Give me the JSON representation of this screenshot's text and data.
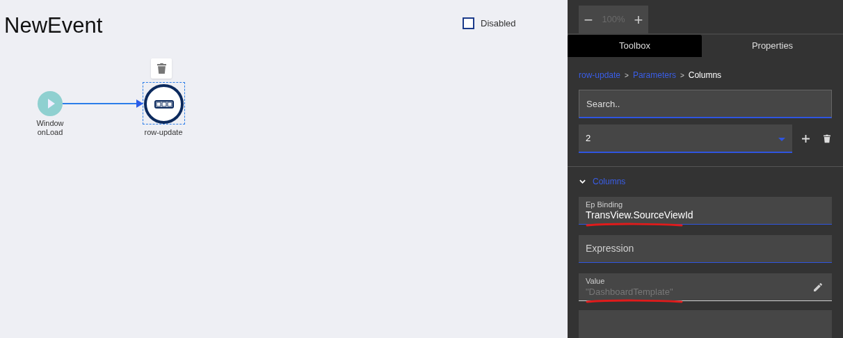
{
  "canvas": {
    "title": "NewEvent",
    "disabled_option": {
      "label": "Disabled",
      "checked": false
    },
    "nodes": [
      {
        "kind": "start",
        "label": "Window onLoad",
        "selected": false
      },
      {
        "kind": "action",
        "label": "row-update",
        "selected": true
      }
    ]
  },
  "panel": {
    "zoom": {
      "minus": "−",
      "value": "100%",
      "plus": "+"
    },
    "tabs": [
      {
        "label": "Toolbox",
        "selected": true
      },
      {
        "label": "Properties",
        "selected": false
      }
    ],
    "breadcrumb": [
      {
        "label": "row-update",
        "current": false
      },
      {
        "label": "Parameters",
        "current": false
      },
      {
        "label": "Columns",
        "current": true
      }
    ],
    "breadcrumb_separator": ">",
    "search": {
      "placeholder": "Search.."
    },
    "select": {
      "value": "2"
    },
    "section": {
      "title": "Columns",
      "expanded": true
    },
    "fields": [
      {
        "label": "Ep Binding",
        "value": "TransView.SourceViewId",
        "underlined_mark": true,
        "editable_icon": false
      },
      {
        "placeholder": "Expression",
        "underlined_mark": false,
        "editable_icon": false
      },
      {
        "label": "Value",
        "placeholder": "\"DashboardTemplate\"",
        "underlined_mark": true,
        "editable_icon": true
      }
    ]
  }
}
